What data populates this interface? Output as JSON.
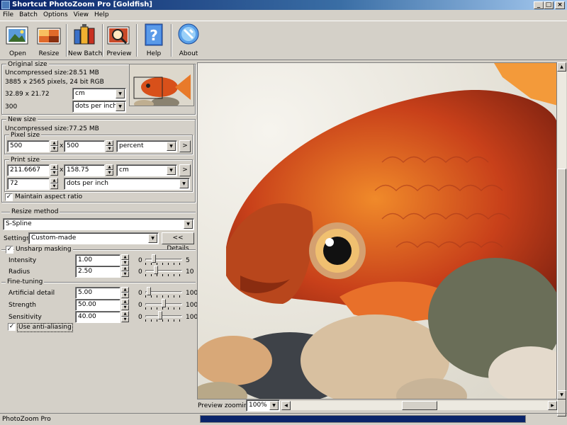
{
  "window": {
    "title": "Shortcut PhotoZoom Pro [Goldfish]",
    "min": "_",
    "max": "□",
    "close": "×"
  },
  "menu": [
    "File",
    "Batch",
    "Options",
    "View",
    "Help"
  ],
  "toolbar": {
    "open": "Open",
    "resize": "Resize",
    "new_batch": "New Batch",
    "preview": "Preview",
    "help": "Help",
    "about": "About"
  },
  "original": {
    "title": "Original size",
    "uncompressed": "Uncompressed size:28.51 MB",
    "pixels": "3885 x 2565 pixels, 24 bit RGB",
    "dims": "32.89 x 21.72",
    "unit": "cm",
    "res": "300",
    "res_unit": "dots per inch"
  },
  "new_size": {
    "title": "New size",
    "uncompressed": "Uncompressed size:77.25 MB",
    "pixel_title": "Pixel size",
    "pixel_w": "500",
    "pixel_x": "x",
    "pixel_h": "500",
    "pixel_unit": "percent",
    "print_title": "Print size",
    "print_w": "211.6667",
    "print_x": "x",
    "print_h": "158.75",
    "print_unit": "cm",
    "print_res": "72",
    "print_res_unit": "dots per inch",
    "arrow": ">",
    "aspect_label": "Maintain aspect ratio",
    "aspect_checked": "✓"
  },
  "method": {
    "title": "Resize method",
    "value": "S-Spline",
    "settings_label": "Settings:",
    "settings_value": "Custom-made",
    "details_button": "<< Details"
  },
  "unsharp": {
    "label": "Unsharp masking",
    "checked": "✓",
    "intensity_label": "Intensity",
    "intensity_value": "1.00",
    "intensity_min": "0",
    "intensity_max": "5",
    "intensity_level": 0.2,
    "radius_label": "Radius",
    "radius_value": "2.50",
    "radius_min": "0",
    "radius_max": "10",
    "radius_level": 0.25
  },
  "fine": {
    "title": "Fine-tuning",
    "detail_label": "Artificial detail",
    "detail_value": "5.00",
    "detail_min": "0",
    "detail_max": "100",
    "detail_level": 0.05,
    "strength_label": "Strength",
    "strength_value": "50.00",
    "strength_min": "0",
    "strength_max": "100",
    "strength_level": 0.5,
    "sensitivity_label": "Sensitivity",
    "sensitivity_value": "40.00",
    "sensitivity_min": "0",
    "sensitivity_max": "100",
    "sensitivity_level": 0.4,
    "aa_label": "Use anti-aliasing",
    "aa_checked": "✓"
  },
  "preview": {
    "zoom_label": "Preview zooming:",
    "zoom_value": "100%"
  },
  "status": {
    "text": "PhotoZoom Pro",
    "progress": 1.0
  }
}
